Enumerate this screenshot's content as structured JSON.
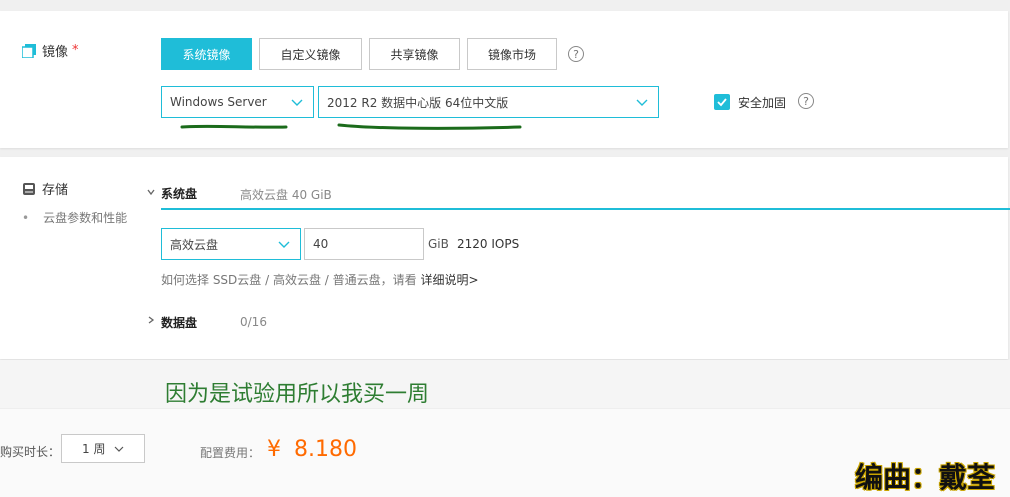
{
  "image_section": {
    "label": "镜像",
    "required_mark": "*",
    "tabs": [
      {
        "label": "系统镜像",
        "active": true
      },
      {
        "label": "自定义镜像",
        "active": false
      },
      {
        "label": "共享镜像",
        "active": false
      },
      {
        "label": "镜像市场",
        "active": false
      }
    ],
    "help_symbol": "?",
    "os_select": {
      "value": "Windows Server"
    },
    "version_select": {
      "value": "2012 R2 数据中心版 64位中文版"
    },
    "security_checkbox": {
      "label": "安全加固",
      "checked": true
    }
  },
  "storage_section": {
    "label": "存储",
    "sub_item": "云盘参数和性能",
    "system_disk": {
      "label": "系统盘",
      "summary": "高效云盘   40 GiB",
      "type_select": "高效云盘",
      "size_value": "40",
      "unit": "GiB",
      "iops": "2120 IOPS",
      "hint_prefix": "如何选择 SSD云盘 / 高效云盘 / 普通云盘，请看",
      "hint_link": "详细说明>"
    },
    "data_disk": {
      "label": "数据盘",
      "count": "0/16"
    }
  },
  "annotation": {
    "text": "因为是试验用所以我买一周",
    "color": "#2e7d32"
  },
  "purchase": {
    "duration_label": "购买时长：",
    "duration_value": "1 周",
    "fee_label": "配置费用：",
    "fee_currency": "¥",
    "fee_amount": "8.180",
    "fee_color": "#ff6a00"
  },
  "watermark": {
    "text": "编曲：戴荃"
  },
  "colors": {
    "accent": "#1fbdd8",
    "marker_green": "#1b6b1b"
  }
}
